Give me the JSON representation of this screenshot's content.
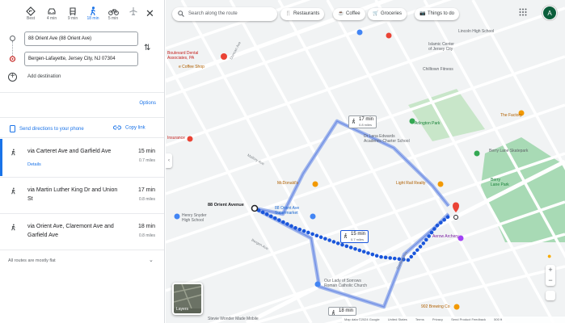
{
  "travel_modes": [
    {
      "name": "best-icon",
      "label": "Best"
    },
    {
      "name": "car-icon",
      "label": "4 min"
    },
    {
      "name": "transit-icon",
      "label": "9 min"
    },
    {
      "name": "walk-icon",
      "label": "18 min",
      "active": true
    },
    {
      "name": "bike-icon",
      "label": "5 min"
    },
    {
      "name": "flight-icon",
      "label": ""
    }
  ],
  "origin": {
    "value": "88 Orient Ave (88 Orient Ave)"
  },
  "destination": {
    "value": "Bergen-Lafayette, Jersey City, NJ 07304"
  },
  "add_destination": "Add destination",
  "options_label": "Options",
  "send_directions_label": "Send directions to your phone",
  "copy_link_label": "Copy link",
  "routes": [
    {
      "via": "via Carteret Ave and Garfield Ave",
      "time": "15 min",
      "distance": "0.7 miles",
      "details": "Details",
      "selected": true
    },
    {
      "via": "via Martin Luther King Dr and Union St",
      "time": "17 min",
      "distance": "0.8 miles"
    },
    {
      "via": "via Orient Ave, Claremont Ave and Garfield Ave",
      "time": "18 min",
      "distance": "0.8 miles"
    }
  ],
  "flat_note": "All routes are mostly flat",
  "map": {
    "search_placeholder": "Search along the route",
    "chips": [
      {
        "icon": "restaurant-icon",
        "glyph": "🍴",
        "label": "Restaurants"
      },
      {
        "icon": "coffee-icon",
        "glyph": "☕",
        "label": "Coffee"
      },
      {
        "icon": "groceries-icon",
        "glyph": "🛒",
        "label": "Groceries"
      },
      {
        "icon": "things-icon",
        "glyph": "📷",
        "label": "Things to do"
      }
    ],
    "avatar_letter": "A",
    "route_tags": [
      {
        "time": "17 min",
        "dist": "0.8 miles"
      },
      {
        "time": "15 min",
        "dist": "0.7 miles"
      },
      {
        "time": "18 min",
        "dist": ""
      }
    ],
    "origin_label": "88 Orient Avenue",
    "places": {
      "boulevard_dental": "Boulevard Dental\nAssociates, PA",
      "lincoln_high": "Lincoln High School",
      "islamic_center": "Islamic Center\nof Jersey City",
      "chilltown": "Chilltown Fitness",
      "arlington_park": "Arlington Park",
      "factory": "The Factory",
      "berry_lane_skatepark": "Berry Lane Skatepark",
      "berry_lane_park": "Berry\nLane Park",
      "lena_edwards": "Dr Lena Edwards\nAcademic Charter School",
      "light_rail": "Light Rail Realty",
      "mcdonalds": "McDonald's",
      "supermarket": "88 Orient Ave\nSupermarket",
      "henry_snyder": "Henry Snyder\nHigh School",
      "our_lady": "Our Lady of Sorrows\nRoman Catholic Church",
      "aerow_archery": "Aerow Archery",
      "brewing": "902 Brewing Co",
      "coffee_shop": "e Coffee Shop",
      "insurance": "Insurance",
      "stevie": "Stevie Wonder Made Mobile"
    },
    "layers_label": "Layers",
    "footer": [
      "Map data ©2024 Google",
      "United States",
      "Terms",
      "Privacy",
      "Send Product Feedback",
      "500 ft"
    ]
  }
}
